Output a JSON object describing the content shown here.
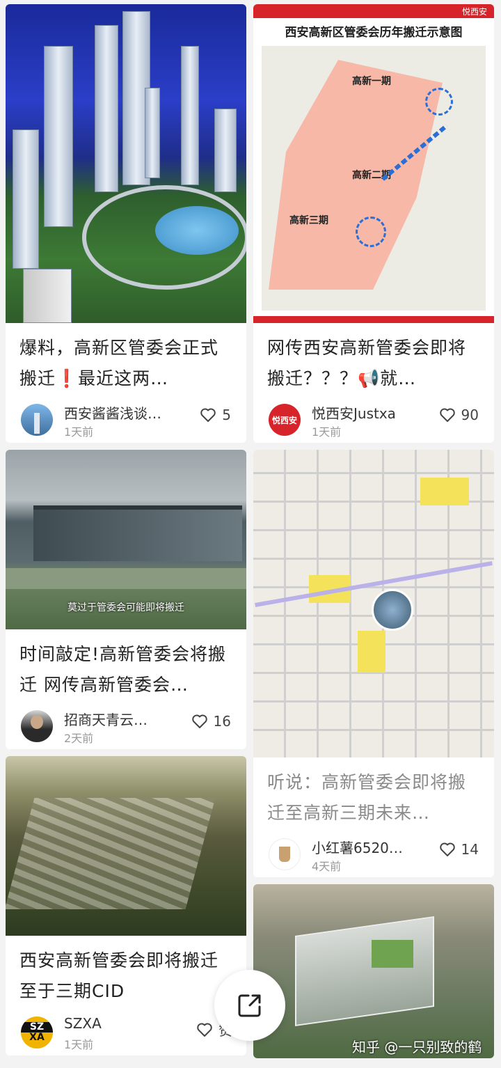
{
  "feed": {
    "left": [
      {
        "title": "爆料，高新区管委会正式搬迁❗️最近这两…",
        "author": "西安酱酱浅谈…",
        "time": "1天前",
        "likes": "5",
        "image": "skyscraper-model"
      },
      {
        "title": "时间敲定!高新管委会将搬迁 网传高新管委会…",
        "author": "招商天青云…",
        "time": "2天前",
        "likes": "16",
        "image": "office-building",
        "image_caption": "莫过于管委会可能即将搬迁"
      },
      {
        "title": "西安高新管委会即将搬迁至于三期CID",
        "author": "SZXA",
        "avatar_text_top": "SZ",
        "avatar_text_bottom": "XA",
        "time": "1天前",
        "likes": "赞",
        "image": "aerial-city"
      }
    ],
    "right": [
      {
        "title": "网传西安高新管委会即将搬迁？？？📢就…",
        "author": "悦西安Justxa",
        "avatar_text": "悦西安",
        "time": "1天前",
        "likes": "90",
        "image": "relocation-map",
        "map_title": "西安高新区管委会历年搬迁示意图",
        "map_brand": "悦西安",
        "map_labels": [
          "高新一期",
          "高新二期",
          "高新三期"
        ]
      },
      {
        "title": "听说：高新管委会即将搬迁至高新三期未来…",
        "author": "小红薯6520…",
        "time": "4天前",
        "likes": "14",
        "image": "street-map"
      },
      {
        "image": "aerial-building"
      }
    ]
  },
  "watermark": "知乎 @一只别致的鹤",
  "colors": {
    "accent_red": "#d7232a",
    "text_primary": "#222222",
    "text_secondary": "#9a9a9a",
    "background": "#f3f3f3"
  },
  "icons": [
    "heart-icon",
    "share-icon"
  ]
}
